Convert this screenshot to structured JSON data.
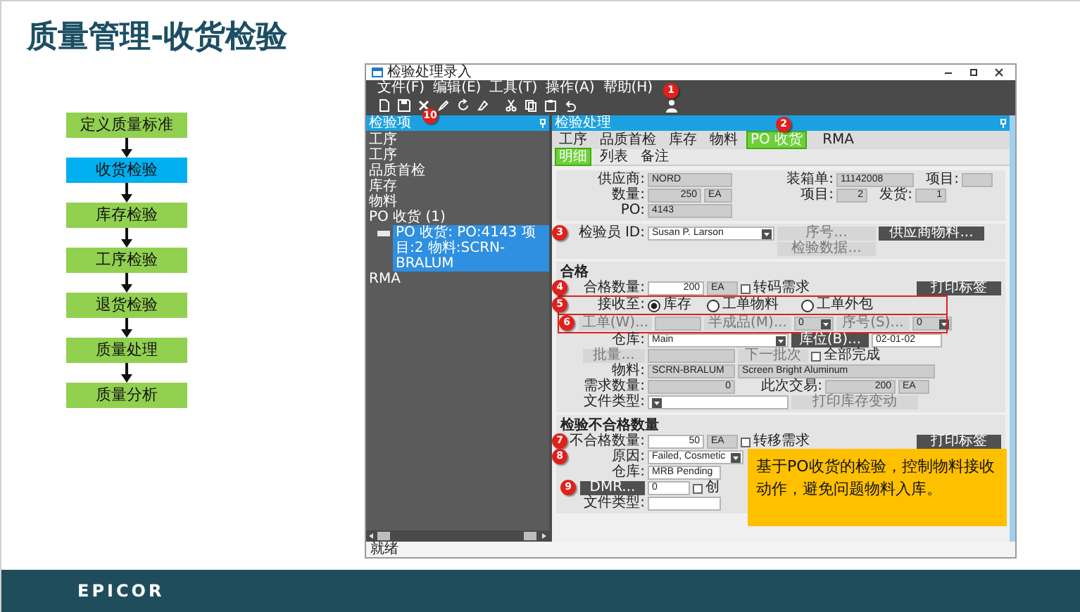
{
  "slide_title": "质量管理-收货检验",
  "process_steps": [
    {
      "label": "定义质量标准",
      "selected": false
    },
    {
      "label": "收货检验",
      "selected": true
    },
    {
      "label": "库存检验",
      "selected": false
    },
    {
      "label": "工序检验",
      "selected": false
    },
    {
      "label": "退货检验",
      "selected": false
    },
    {
      "label": "质量处理",
      "selected": false
    },
    {
      "label": "质量分析",
      "selected": false
    }
  ],
  "app": {
    "title": "检验处理录入",
    "menu": [
      "文件(F)",
      "编辑(E)",
      "工具(T)",
      "操作(A)",
      "帮助(H)"
    ],
    "toolbar": {
      "save_marker": "10",
      "user_marker": "1"
    },
    "tree_panel": {
      "title": "检验项",
      "items": [
        {
          "label": "工序",
          "selected": false
        },
        {
          "label": "工序",
          "selected": false
        },
        {
          "label": "品质首检",
          "selected": false
        },
        {
          "label": "库存",
          "selected": false
        },
        {
          "label": "物料",
          "selected": false
        },
        {
          "label": "PO 收货 (1)",
          "selected": false,
          "children": [
            {
              "label": "PO 收货: PO:4143 项目:2 物料:SCRN-BRALUM",
              "selected": true
            }
          ]
        },
        {
          "label": "RMA",
          "selected": false
        }
      ]
    },
    "main_panel": {
      "title": "检验处理",
      "tabs": [
        {
          "label": "工序",
          "selected": false
        },
        {
          "label": "品质首检",
          "selected": false
        },
        {
          "label": "库存",
          "selected": false
        },
        {
          "label": "物料",
          "selected": false
        },
        {
          "label": "PO 收货",
          "selected": true,
          "marker": "2"
        },
        {
          "label": "RMA",
          "selected": false
        }
      ],
      "subtabs": [
        {
          "label": "明细",
          "selected": true
        },
        {
          "label": "列表",
          "selected": false
        },
        {
          "label": "备注",
          "selected": false
        }
      ],
      "sections": [
        {
          "rows": [
            {
              "highlighted": false,
              "items": [
                {
                  "kind": "label",
                  "text": "供应商:"
                },
                {
                  "kind": "field",
                  "value": "NORD",
                  "readonly": true
                },
                {
                  "kind": "label",
                  "text": "装箱单:"
                },
                {
                  "kind": "field",
                  "value": "11142008",
                  "readonly": true
                },
                {
                  "kind": "label",
                  "text": "项目:"
                },
                {
                  "kind": "field",
                  "readonly": true
                }
              ]
            },
            {
              "highlighted": false,
              "items": [
                {
                  "kind": "label",
                  "text": "数量:"
                },
                {
                  "kind": "numfield",
                  "value": "250",
                  "readonly": true
                },
                {
                  "kind": "field",
                  "value": "EA",
                  "readonly": true
                },
                {
                  "kind": "label",
                  "text": "项目:"
                },
                {
                  "kind": "numfield",
                  "value": "2",
                  "readonly": true
                },
                {
                  "kind": "label",
                  "text": "发货:"
                },
                {
                  "kind": "numfield",
                  "value": "1",
                  "readonly": true
                }
              ]
            },
            {
              "highlighted": false,
              "items": [
                {
                  "kind": "label",
                  "text": "PO:"
                },
                {
                  "kind": "field",
                  "value": "4143",
                  "readonly": true
                }
              ]
            }
          ]
        },
        {
          "rows": [
            {
              "highlighted": false,
              "items": [
                {
                  "kind": "label",
                  "text": "检验员 ID:",
                  "marker": "3"
                },
                {
                  "kind": "dropdown",
                  "value": "Susan P. Larson",
                  "readonly": false
                },
                {
                  "kind": "button",
                  "text": "序号...",
                  "disabled": true
                },
                {
                  "kind": "button",
                  "text": "供应商物料...",
                  "disabled": false
                }
              ]
            },
            {
              "highlighted": false,
              "items": [
                {
                  "kind": "button",
                  "text": "检验数据...",
                  "disabled": true
                }
              ]
            }
          ]
        },
        {
          "title": "合格",
          "rows": [
            {
              "highlighted": false,
              "items": [
                {
                  "kind": "label",
                  "text": "合格数量:",
                  "marker": "4"
                },
                {
                  "kind": "numfield",
                  "value": "200",
                  "readonly": false
                },
                {
                  "kind": "field",
                  "value": "EA",
                  "readonly": true
                },
                {
                  "kind": "checkbox",
                  "text": "转码需求",
                  "checked": false
                },
                {
                  "kind": "button",
                  "text": "打印标签",
                  "disabled": false
                }
              ]
            },
            {
              "highlighted": true,
              "items": [
                {
                  "kind": "label",
                  "text": "接收至:",
                  "marker": "5"
                },
                {
                  "kind": "radio",
                  "text": "库存",
                  "selected": true
                },
                {
                  "kind": "radio",
                  "text": "工单物料",
                  "selected": false
                },
                {
                  "kind": "radio",
                  "text": "工单外包",
                  "selected": false
                }
              ]
            },
            {
              "highlighted": true,
              "items": [
                {
                  "kind": "button",
                  "text": "工单(W)...",
                  "disabled": true,
                  "marker": "6"
                },
                {
                  "kind": "field",
                  "readonly": true
                },
                {
                  "kind": "button",
                  "text": "半成品(M)...",
                  "disabled": true
                },
                {
                  "kind": "dropdown",
                  "value": "0",
                  "readonly": true
                },
                {
                  "kind": "button",
                  "text": "序号(S)...",
                  "disabled": true
                },
                {
                  "kind": "dropdown",
                  "value": "0",
                  "readonly": true
                }
              ]
            },
            {
              "highlighted": false,
              "items": [
                {
                  "kind": "label",
                  "text": "仓库:"
                },
                {
                  "kind": "dropdown",
                  "value": "Main",
                  "readonly": false
                },
                {
                  "kind": "button",
                  "text": "库位(B)...",
                  "disabled": false
                },
                {
                  "kind": "field",
                  "value": "02-01-02",
                  "readonly": false
                }
              ]
            },
            {
              "highlighted": false,
              "items": [
                {
                  "kind": "button",
                  "text": "批量...",
                  "disabled": true
                },
                {
                  "kind": "field",
                  "readonly": true
                },
                {
                  "kind": "button",
                  "text": "下一批次",
                  "disabled": true
                },
                {
                  "kind": "checkbox",
                  "text": "全部完成",
                  "checked": false
                }
              ]
            },
            {
              "highlighted": false,
              "items": [
                {
                  "kind": "label",
                  "text": "物料:"
                },
                {
                  "kind": "field",
                  "value": "SCRN-BRALUM",
                  "readonly": true
                },
                {
                  "kind": "field",
                  "value": "Screen Bright Aluminum",
                  "readonly": true
                }
              ]
            },
            {
              "highlighted": false,
              "items": [
                {
                  "kind": "label",
                  "text": "需求数量:"
                },
                {
                  "kind": "numfield",
                  "value": "0",
                  "readonly": true
                },
                {
                  "kind": "label",
                  "text": "此次交易:"
                },
                {
                  "kind": "numfield",
                  "value": "200",
                  "readonly": true
                },
                {
                  "kind": "field",
                  "value": "EA",
                  "readonly": true
                }
              ]
            },
            {
              "highlighted": false,
              "items": [
                {
                  "kind": "label",
                  "text": "文件类型:"
                },
                {
                  "kind": "dropdown",
                  "readonly": false
                },
                {
                  "kind": "button",
                  "text": "打印库存变动",
                  "disabled": true
                }
              ]
            }
          ]
        },
        {
          "title": "检验不合格数量",
          "rows": [
            {
              "highlighted": false,
              "items": [
                {
                  "kind": "label",
                  "text": "不合格数量:",
                  "marker": "7"
                },
                {
                  "kind": "numfield",
                  "value": "50",
                  "readonly": false
                },
                {
                  "kind": "field",
                  "value": "EA",
                  "readonly": true
                },
                {
                  "kind": "checkbox",
                  "text": "转移需求",
                  "checked": false
                },
                {
                  "kind": "button",
                  "text": "打印标签",
                  "disabled": false
                }
              ]
            },
            {
              "highlighted": false,
              "items": [
                {
                  "kind": "label",
                  "text": "原因:",
                  "marker": "8"
                },
                {
                  "kind": "dropdown",
                  "value": "Failed, Cosmetic",
                  "readonly": false
                }
              ]
            },
            {
              "highlighted": false,
              "items": [
                {
                  "kind": "label",
                  "text": "仓库:"
                },
                {
                  "kind": "field",
                  "value": "MRB Pending",
                  "readonly": false
                }
              ]
            },
            {
              "highlighted": false,
              "items": [
                {
                  "kind": "button",
                  "text": "DMR...",
                  "disabled": false,
                  "marker": "9"
                },
                {
                  "kind": "field",
                  "value": "0",
                  "readonly": false
                },
                {
                  "kind": "checkbox",
                  "text": "创",
                  "checked": false
                }
              ]
            },
            {
              "highlighted": false,
              "items": [
                {
                  "kind": "label",
                  "text": "文件类型:"
                },
                {
                  "kind": "field",
                  "readonly": false
                }
              ]
            }
          ]
        }
      ]
    },
    "status_bar": "就绪"
  },
  "callout": "基于PO收货的检验，控制物料接收动作，避免问题物料入库。",
  "footer": {
    "logo": "EPICOR"
  }
}
